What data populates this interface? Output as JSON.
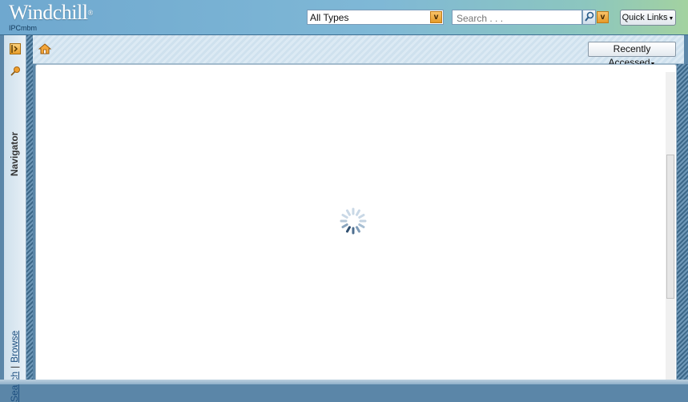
{
  "header": {
    "logo": "Windchill",
    "logo_mark": "®",
    "site_name": "IPCmbm",
    "type_select": {
      "value": "All Types"
    },
    "search": {
      "placeholder": "Search . . ."
    },
    "quick_links_label": "Quick Links"
  },
  "navigator": {
    "title": "Navigator",
    "links": {
      "search": "Search",
      "separator": "|",
      "browse": "Browse"
    }
  },
  "toolbar": {
    "recently_accessed_label": "Recently Accessed"
  },
  "content": {
    "state": "loading",
    "icons": [
      "spinner-icon"
    ]
  },
  "colors": {
    "accent_orange": "#e89e2c",
    "header_blue": "#6fa8cf",
    "link_blue": "#1d4f80"
  }
}
